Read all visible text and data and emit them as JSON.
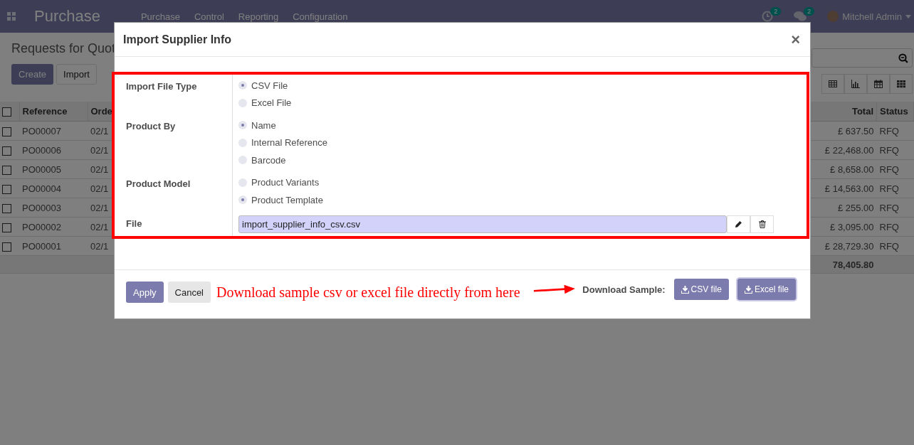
{
  "navbar": {
    "app_name": "Purchase",
    "menu": [
      "Purchase",
      "Control",
      "Reporting",
      "Configuration"
    ],
    "activity_count": "2",
    "message_count": "2",
    "user": "Mitchell Admin"
  },
  "page": {
    "title": "Requests for Quot",
    "buttons": [
      "Create",
      "Import"
    ],
    "table": {
      "select_all": false,
      "columns": [
        "Reference",
        "Orde",
        "Total",
        "Status"
      ],
      "rows": [
        {
          "checked": false,
          "reference": "PO00007",
          "order": "02/1",
          "total": "£ 637.50",
          "status": "RFQ"
        },
        {
          "checked": false,
          "reference": "PO00006",
          "order": "02/1",
          "total": "£ 22,468.00",
          "status": "RFQ"
        },
        {
          "checked": false,
          "reference": "PO00005",
          "order": "02/1",
          "total": "£ 8,658.00",
          "status": "RFQ"
        },
        {
          "checked": false,
          "reference": "PO00004",
          "order": "02/1",
          "total": "£ 14,563.00",
          "status": "RFQ"
        },
        {
          "checked": false,
          "reference": "PO00003",
          "order": "02/1",
          "total": "£ 255.00",
          "status": "RFQ"
        },
        {
          "checked": false,
          "reference": "PO00002",
          "order": "02/1",
          "total": "£ 3,095.00",
          "status": "RFQ"
        },
        {
          "checked": false,
          "reference": "PO00001",
          "order": "02/1",
          "total": "£ 28,729.30",
          "status": "RFQ"
        }
      ],
      "sum": "78,405.80"
    }
  },
  "modal": {
    "title": "Import Supplier Info",
    "close": "×",
    "fields": [
      {
        "kind": "radio",
        "label": "Import File Type",
        "options": [
          {
            "label": "CSV File",
            "selected": true
          },
          {
            "label": "Excel File",
            "selected": false
          }
        ]
      },
      {
        "kind": "radio",
        "label": "Product By",
        "options": [
          {
            "label": "Name",
            "selected": true
          },
          {
            "label": "Internal Reference",
            "selected": false
          },
          {
            "label": "Barcode",
            "selected": false
          }
        ]
      },
      {
        "kind": "radio",
        "label": "Product Model",
        "options": [
          {
            "label": "Product Variants",
            "selected": false
          },
          {
            "label": "Product Template",
            "selected": true
          }
        ]
      },
      {
        "kind": "file",
        "label": "File",
        "value": "import_supplier_info_csv.csv"
      }
    ],
    "buttons": [
      {
        "label": "Apply",
        "kind": "primary"
      },
      {
        "label": "Cancel",
        "kind": "secondary"
      }
    ],
    "annotation": "Download sample csv or excel file directly from here",
    "download_label": "Download Sample:",
    "downloads": [
      {
        "label": "CSV file",
        "focused": false
      },
      {
        "label": "Excel file",
        "focused": true
      }
    ]
  }
}
